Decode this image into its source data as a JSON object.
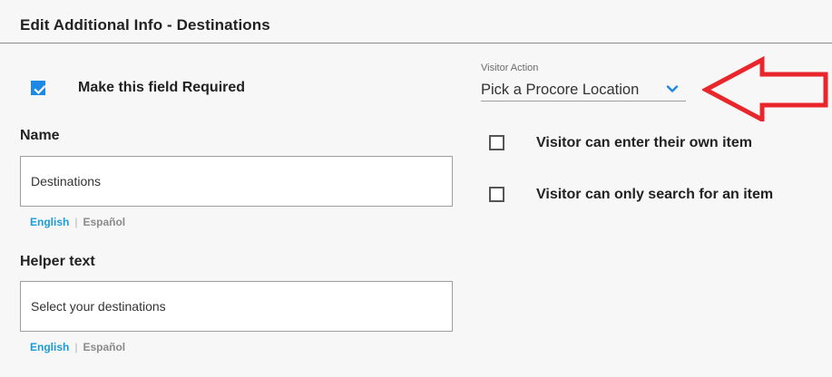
{
  "header": {
    "title": "Edit Additional Info - Destinations"
  },
  "required": {
    "label": "Make this field Required",
    "checked": true
  },
  "name_field": {
    "label": "Name",
    "value": "Destinations",
    "lang_en": "English",
    "lang_sep": "|",
    "lang_es": "Español"
  },
  "helper_field": {
    "label": "Helper text",
    "value": "Select your destinations",
    "lang_en": "English",
    "lang_sep": "|",
    "lang_es": "Español"
  },
  "visitor_action": {
    "caption": "Visitor Action",
    "selected": "Pick a Procore Location"
  },
  "options": [
    {
      "label": "Visitor can enter their own item",
      "checked": false
    },
    {
      "label": "Visitor can only search for an item",
      "checked": false
    }
  ],
  "colors": {
    "accent_blue": "#1e88e5",
    "link_blue": "#1a9cd8",
    "annotation_red": "#e8262b"
  },
  "icons": {
    "checkmark": "check-icon",
    "dropdown": "chevron-down-icon",
    "annotation": "left-arrow-icon"
  }
}
